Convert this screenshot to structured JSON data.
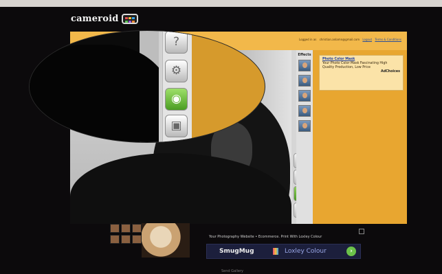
{
  "header": {
    "logo_text": "cameroid",
    "login_prefix": "Logged in as",
    "login_email": "christian.anlamn@gmail.com",
    "logout_label": "Logout",
    "terms_label": "Terms & Conditions"
  },
  "toolbar": {
    "icons": [
      "help-icon",
      "settings-icon",
      "camera-icon",
      "multi-shot-icon"
    ],
    "effects_label": "Effects"
  },
  "ad": {
    "title": "Photo Color Mask",
    "body": "Your Photo Color Mask Fascinating High Quality Production, Low Price",
    "choices": "AdChoices"
  },
  "bottom_ad": {
    "text": "Your Photography Website • Ecommerce. Print With Loxley Colour",
    "smugmug": "SmugMug",
    "loxley": "Loxley Colour",
    "go": "›"
  },
  "footer": {
    "text": "Send Gallery"
  },
  "colors": {
    "accent": "#e8a630",
    "green": "#6cc24a",
    "background": "#0c0a0c"
  }
}
